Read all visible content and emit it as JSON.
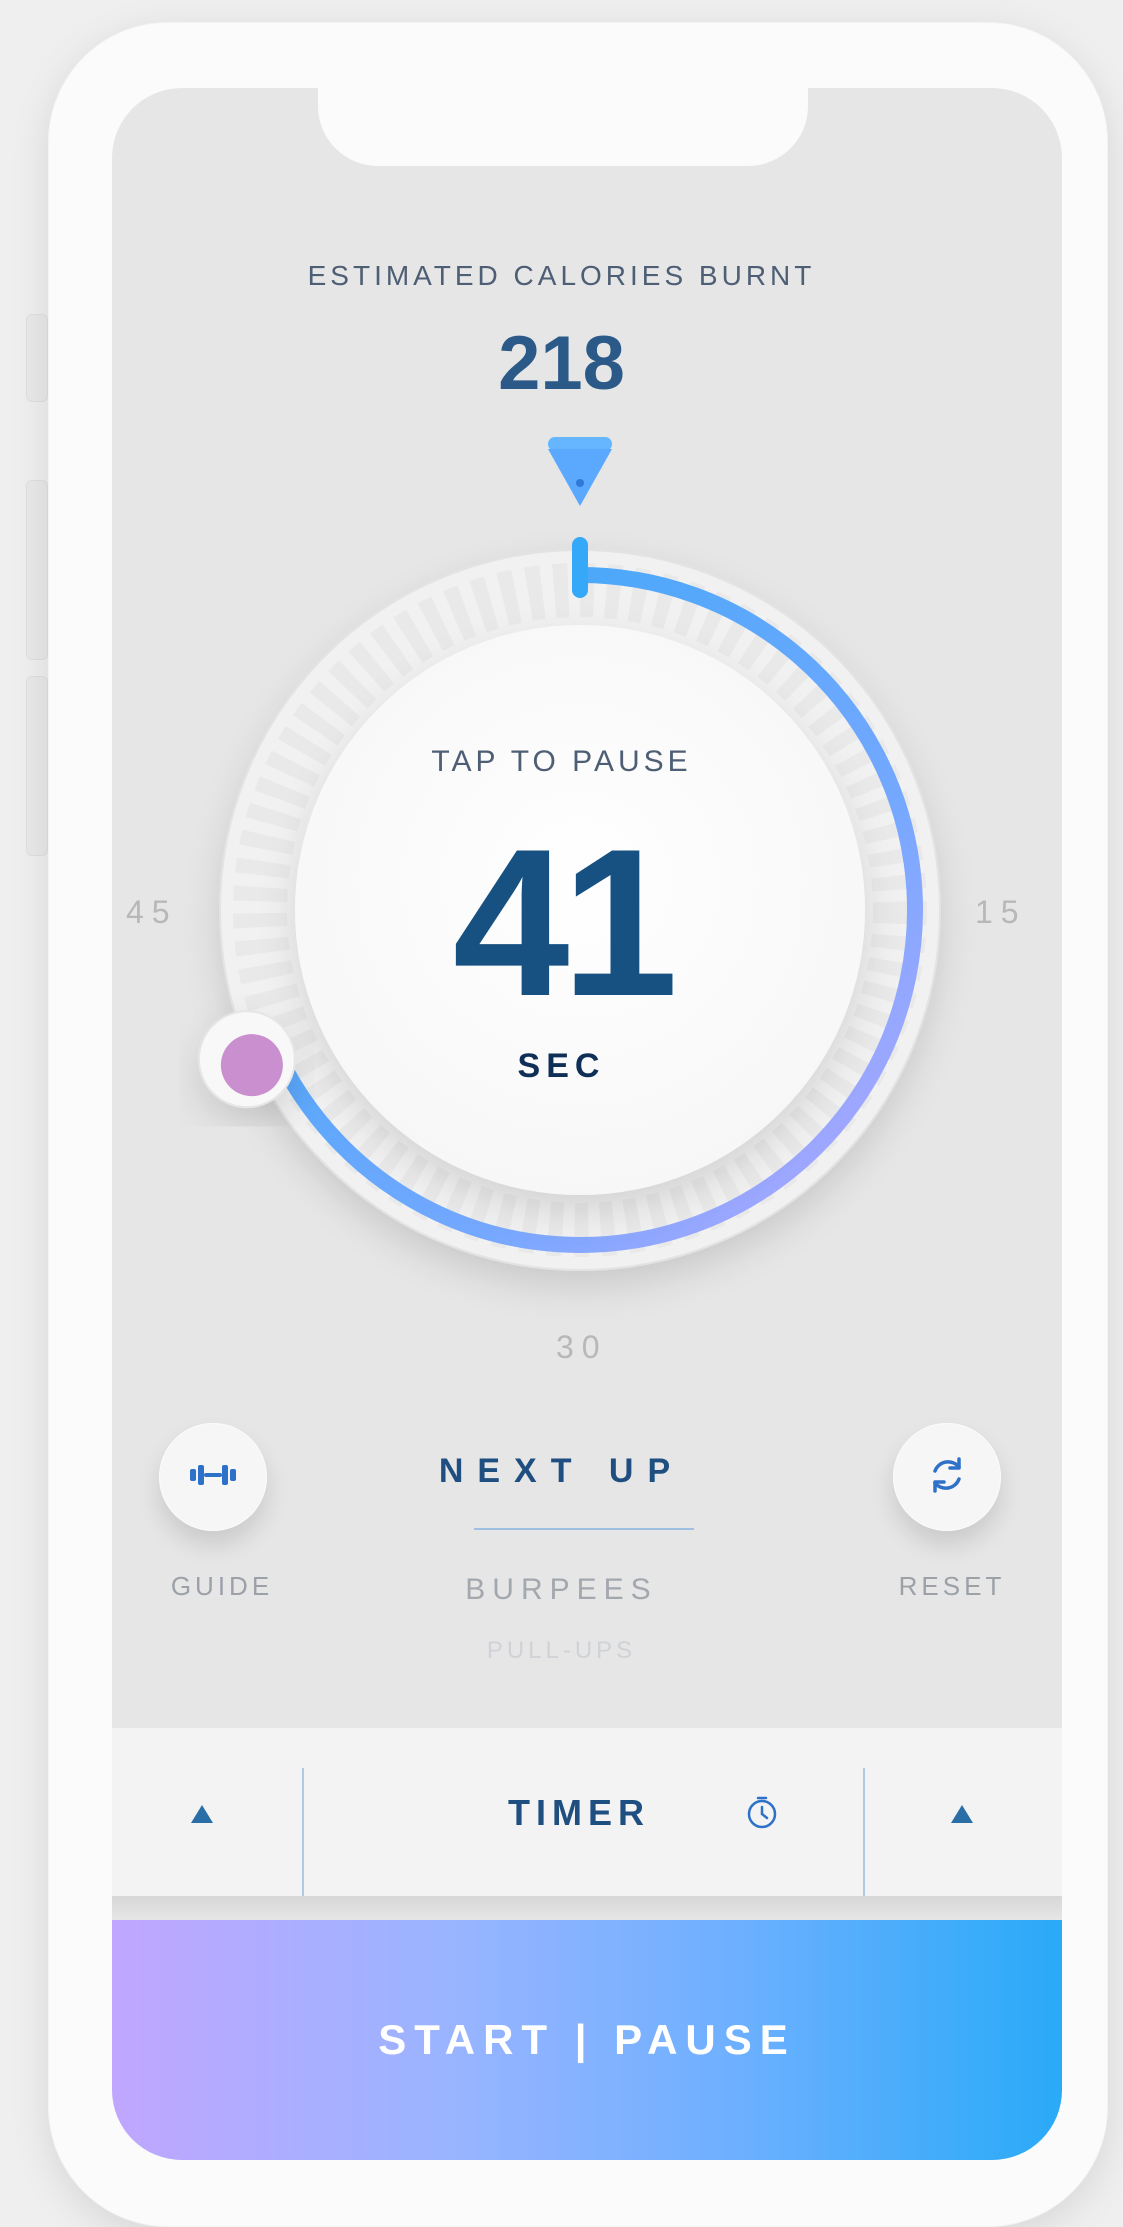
{
  "calories": {
    "label": "ESTIMATED CALORIES BURNT",
    "value": "218"
  },
  "timer_display": {
    "hint": "TAP TO PAUSE",
    "value": "41",
    "unit": "SEC",
    "progress_fraction": 0.683
  },
  "dial_labels": {
    "left": "45",
    "right": "15",
    "bottom": "30"
  },
  "guide": {
    "label": "GUIDE",
    "icon": "dumbbell-icon"
  },
  "reset": {
    "label": "RESET",
    "icon": "refresh-icon"
  },
  "next_up": {
    "title": "NEXT UP",
    "items": [
      "BURPEES",
      "PULL-UPS"
    ]
  },
  "timer_bar": {
    "label": "TIMER",
    "icon": "stopwatch-icon"
  },
  "start_pause": {
    "label": "START | PAUSE"
  },
  "colors": {
    "accent_blue": "#29aaf7",
    "accent_purple": "#c0a6ff",
    "text_dark_blue": "#175182",
    "knob_pink": "#c98fcf"
  }
}
